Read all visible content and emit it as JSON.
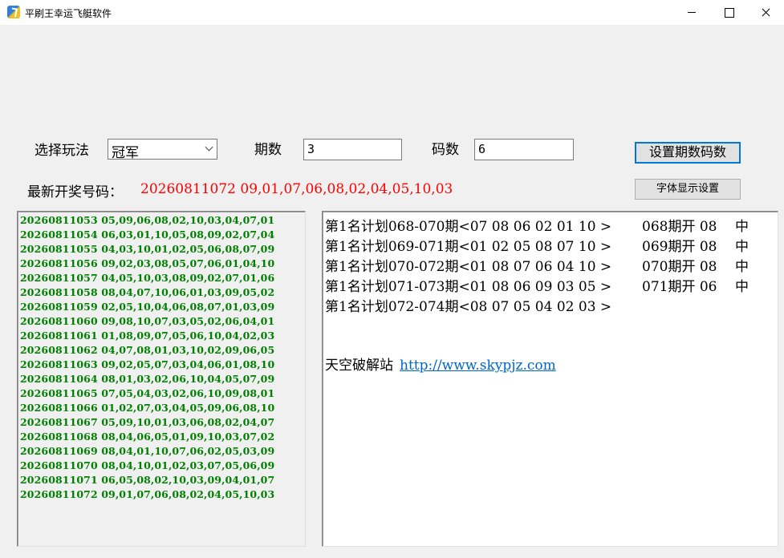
{
  "window": {
    "title": "平刷王幸运飞艇软件"
  },
  "controls": {
    "mode_label": "选择玩法",
    "mode_value": "冠军",
    "period_label": "期数",
    "period_value": "3",
    "code_label": "码数",
    "code_value": "6",
    "set_button": "设置期数码数",
    "font_button": "字体显示设置"
  },
  "latest": {
    "label": "最新开奖号码：",
    "value": "20260811072  09,01,07,06,08,02,04,05,10,03"
  },
  "history": [
    "20260811053 05,09,06,08,02,10,03,04,07,01",
    "20260811054 06,03,01,10,05,08,09,02,07,04",
    "20260811055 04,03,10,01,02,05,06,08,07,09",
    "20260811056 09,02,03,08,05,07,06,01,04,10",
    "20260811057 04,05,10,03,08,09,02,07,01,06",
    "20260811058 08,04,07,10,06,01,03,09,05,02",
    "20260811059 02,05,10,04,06,08,07,01,03,09",
    "20260811060 09,08,10,07,03,05,02,06,04,01",
    "20260811061 01,08,09,07,05,06,10,04,02,03",
    "20260811062 04,07,08,01,03,10,02,09,06,05",
    "20260811063 09,02,05,07,03,04,06,01,08,10",
    "20260811064 08,01,03,02,06,10,04,05,07,09",
    "20260811065 07,05,04,03,02,06,10,09,08,01",
    "20260811066 01,02,07,03,04,05,09,06,08,10",
    "20260811067 05,09,10,01,03,06,08,02,04,07",
    "20260811068 08,04,06,05,01,09,10,03,07,02",
    "20260811069 08,04,01,10,07,06,02,05,03,09",
    "20260811070 08,04,10,01,02,03,07,05,06,09",
    "20260811071 06,05,08,02,10,03,09,04,01,07",
    "20260811072 09,01,07,06,08,02,04,05,10,03"
  ],
  "plans": [
    {
      "text": "第1名计划068-070期<07 08 06 02 01 10 >",
      "result": "068期开 08",
      "hit": "中"
    },
    {
      "text": "第1名计划069-071期<01 02 05 08 07 10 >",
      "result": "069期开 08",
      "hit": "中"
    },
    {
      "text": "第1名计划070-072期<01 08 07 06 04 10 >",
      "result": "070期开 08",
      "hit": "中"
    },
    {
      "text": "第1名计划071-073期<01 08 06 09 03 05 >",
      "result": "071期开 06",
      "hit": "中"
    },
    {
      "text": "第1名计划072-074期<08 07 05 04 02 03 >",
      "result": "",
      "hit": ""
    }
  ],
  "site": {
    "label": "天空破解站",
    "link": "http://www.skypjz.com"
  }
}
